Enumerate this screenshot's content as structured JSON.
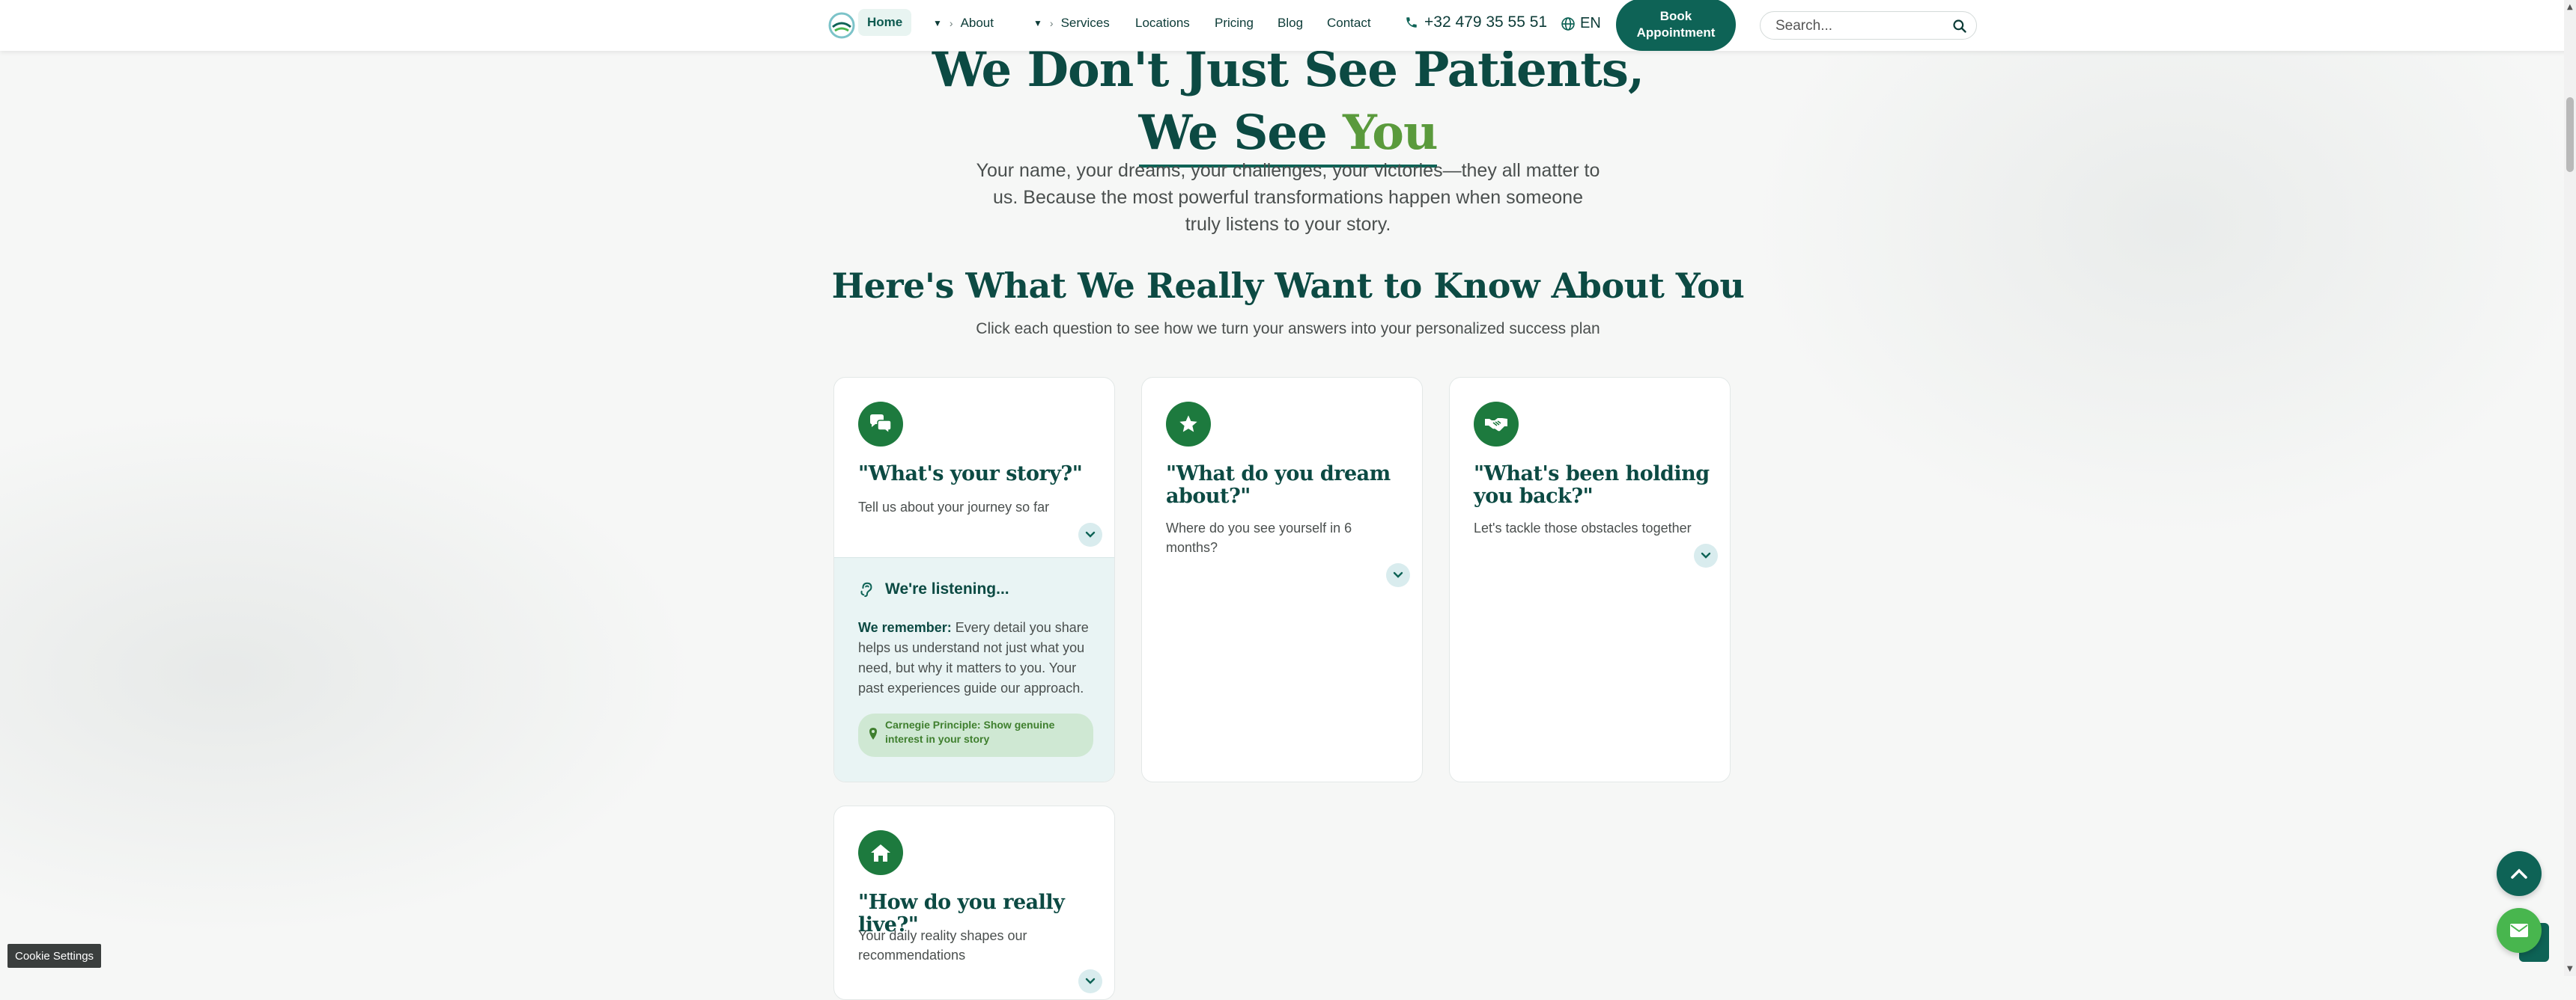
{
  "colors": {
    "brand_dark": "#0c4a43",
    "brand_teal": "#0e6356",
    "accent_green": "#5a9a3c",
    "icon_green": "#1d7a3e"
  },
  "nav": {
    "home": "Home",
    "about": "About",
    "services": "Services",
    "locations": "Locations",
    "pricing": "Pricing",
    "blog": "Blog",
    "contact": "Contact",
    "phone": "+32 479 35 55 51",
    "lang": "EN",
    "book_line1": "Book",
    "book_line2": "Appointment",
    "search_placeholder": "Search..."
  },
  "hero": {
    "title_line1": "We Don't Just See Patients,",
    "title_we_see": "We See ",
    "title_you": "You",
    "subtitle": "Your name, your dreams, your challenges, your victories—they all matter to us. Because the most powerful transformations happen when someone truly listens to your story."
  },
  "section": {
    "title": "Here's What We Really Want to Know About You",
    "subtitle": "Click each question to see how we turn your answers into your personalized success plan"
  },
  "cards": [
    {
      "icon": "chat-bubbles-icon",
      "question": "\"What's your story?\"",
      "description": "Tell us about your journey so far",
      "expanded": {
        "heading": "We're listening...",
        "bold": "We remember:",
        "body": " Every detail you share helps us understand not just what you need, but why it matters to you. Your past experiences guide our approach.",
        "pill": "Carnegie Principle: Show genuine interest in your story"
      }
    },
    {
      "icon": "star-icon",
      "question": "\"What do you dream about?\"",
      "description": "Where do you see yourself in 6 months?"
    },
    {
      "icon": "handshake-icon",
      "question": "\"What's been holding you back?\"",
      "description": "Let's tackle those obstacles together"
    },
    {
      "icon": "home-icon",
      "question": "\"How do you really live?\"",
      "description": "Your daily reality shapes our recommendations"
    }
  ],
  "footer": {
    "cookie": "Cookie Settings"
  }
}
